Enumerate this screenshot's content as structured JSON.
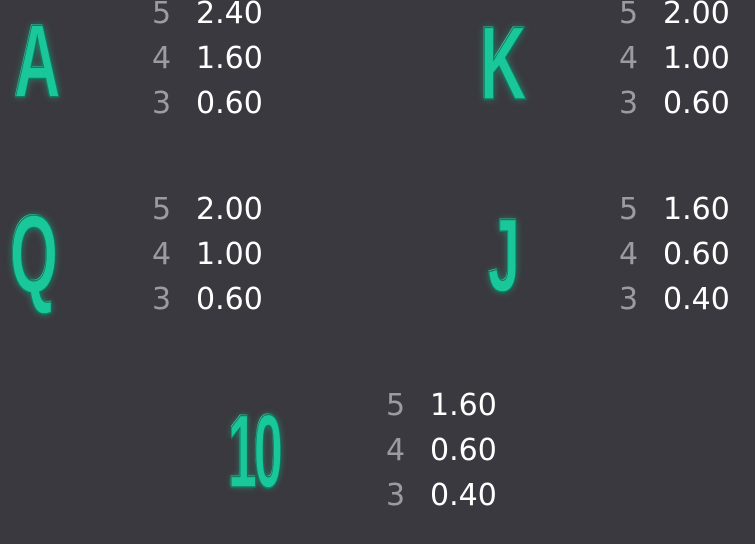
{
  "symbols": [
    {
      "id": "a",
      "label": "A",
      "payouts": [
        {
          "count": "5",
          "value": "2.40"
        },
        {
          "count": "4",
          "value": "1.60"
        },
        {
          "count": "3",
          "value": "0.60"
        }
      ]
    },
    {
      "id": "k",
      "label": "K",
      "payouts": [
        {
          "count": "5",
          "value": "2.00"
        },
        {
          "count": "4",
          "value": "1.00"
        },
        {
          "count": "3",
          "value": "0.60"
        }
      ]
    },
    {
      "id": "q",
      "label": "Q",
      "payouts": [
        {
          "count": "5",
          "value": "2.00"
        },
        {
          "count": "4",
          "value": "1.00"
        },
        {
          "count": "3",
          "value": "0.60"
        }
      ]
    },
    {
      "id": "j",
      "label": "J",
      "payouts": [
        {
          "count": "5",
          "value": "1.60"
        },
        {
          "count": "4",
          "value": "0.60"
        },
        {
          "count": "3",
          "value": "0.40"
        }
      ]
    },
    {
      "id": "10",
      "label": "10",
      "payouts": [
        {
          "count": "5",
          "value": "1.60"
        },
        {
          "count": "4",
          "value": "0.60"
        },
        {
          "count": "3",
          "value": "0.40"
        }
      ]
    }
  ],
  "colors": {
    "background": "#3a393f",
    "symbol": "#19c79a",
    "count_text": "#9c9ba2",
    "value_text": "#ffffff"
  }
}
